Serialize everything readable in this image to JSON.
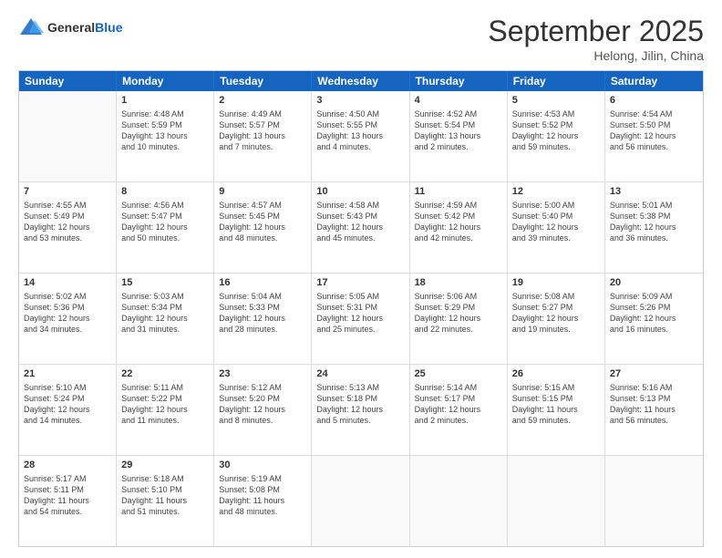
{
  "logo": {
    "general": "General",
    "blue": "Blue"
  },
  "title": "September 2025",
  "subtitle": "Helong, Jilin, China",
  "days": [
    "Sunday",
    "Monday",
    "Tuesday",
    "Wednesday",
    "Thursday",
    "Friday",
    "Saturday"
  ],
  "weeks": [
    [
      {
        "day": "",
        "info": ""
      },
      {
        "day": "1",
        "info": "Sunrise: 4:48 AM\nSunset: 5:59 PM\nDaylight: 13 hours\nand 10 minutes."
      },
      {
        "day": "2",
        "info": "Sunrise: 4:49 AM\nSunset: 5:57 PM\nDaylight: 13 hours\nand 7 minutes."
      },
      {
        "day": "3",
        "info": "Sunrise: 4:50 AM\nSunset: 5:55 PM\nDaylight: 13 hours\nand 4 minutes."
      },
      {
        "day": "4",
        "info": "Sunrise: 4:52 AM\nSunset: 5:54 PM\nDaylight: 13 hours\nand 2 minutes."
      },
      {
        "day": "5",
        "info": "Sunrise: 4:53 AM\nSunset: 5:52 PM\nDaylight: 12 hours\nand 59 minutes."
      },
      {
        "day": "6",
        "info": "Sunrise: 4:54 AM\nSunset: 5:50 PM\nDaylight: 12 hours\nand 56 minutes."
      }
    ],
    [
      {
        "day": "7",
        "info": "Sunrise: 4:55 AM\nSunset: 5:49 PM\nDaylight: 12 hours\nand 53 minutes."
      },
      {
        "day": "8",
        "info": "Sunrise: 4:56 AM\nSunset: 5:47 PM\nDaylight: 12 hours\nand 50 minutes."
      },
      {
        "day": "9",
        "info": "Sunrise: 4:57 AM\nSunset: 5:45 PM\nDaylight: 12 hours\nand 48 minutes."
      },
      {
        "day": "10",
        "info": "Sunrise: 4:58 AM\nSunset: 5:43 PM\nDaylight: 12 hours\nand 45 minutes."
      },
      {
        "day": "11",
        "info": "Sunrise: 4:59 AM\nSunset: 5:42 PM\nDaylight: 12 hours\nand 42 minutes."
      },
      {
        "day": "12",
        "info": "Sunrise: 5:00 AM\nSunset: 5:40 PM\nDaylight: 12 hours\nand 39 minutes."
      },
      {
        "day": "13",
        "info": "Sunrise: 5:01 AM\nSunset: 5:38 PM\nDaylight: 12 hours\nand 36 minutes."
      }
    ],
    [
      {
        "day": "14",
        "info": "Sunrise: 5:02 AM\nSunset: 5:36 PM\nDaylight: 12 hours\nand 34 minutes."
      },
      {
        "day": "15",
        "info": "Sunrise: 5:03 AM\nSunset: 5:34 PM\nDaylight: 12 hours\nand 31 minutes."
      },
      {
        "day": "16",
        "info": "Sunrise: 5:04 AM\nSunset: 5:33 PM\nDaylight: 12 hours\nand 28 minutes."
      },
      {
        "day": "17",
        "info": "Sunrise: 5:05 AM\nSunset: 5:31 PM\nDaylight: 12 hours\nand 25 minutes."
      },
      {
        "day": "18",
        "info": "Sunrise: 5:06 AM\nSunset: 5:29 PM\nDaylight: 12 hours\nand 22 minutes."
      },
      {
        "day": "19",
        "info": "Sunrise: 5:08 AM\nSunset: 5:27 PM\nDaylight: 12 hours\nand 19 minutes."
      },
      {
        "day": "20",
        "info": "Sunrise: 5:09 AM\nSunset: 5:26 PM\nDaylight: 12 hours\nand 16 minutes."
      }
    ],
    [
      {
        "day": "21",
        "info": "Sunrise: 5:10 AM\nSunset: 5:24 PM\nDaylight: 12 hours\nand 14 minutes."
      },
      {
        "day": "22",
        "info": "Sunrise: 5:11 AM\nSunset: 5:22 PM\nDaylight: 12 hours\nand 11 minutes."
      },
      {
        "day": "23",
        "info": "Sunrise: 5:12 AM\nSunset: 5:20 PM\nDaylight: 12 hours\nand 8 minutes."
      },
      {
        "day": "24",
        "info": "Sunrise: 5:13 AM\nSunset: 5:18 PM\nDaylight: 12 hours\nand 5 minutes."
      },
      {
        "day": "25",
        "info": "Sunrise: 5:14 AM\nSunset: 5:17 PM\nDaylight: 12 hours\nand 2 minutes."
      },
      {
        "day": "26",
        "info": "Sunrise: 5:15 AM\nSunset: 5:15 PM\nDaylight: 11 hours\nand 59 minutes."
      },
      {
        "day": "27",
        "info": "Sunrise: 5:16 AM\nSunset: 5:13 PM\nDaylight: 11 hours\nand 56 minutes."
      }
    ],
    [
      {
        "day": "28",
        "info": "Sunrise: 5:17 AM\nSunset: 5:11 PM\nDaylight: 11 hours\nand 54 minutes."
      },
      {
        "day": "29",
        "info": "Sunrise: 5:18 AM\nSunset: 5:10 PM\nDaylight: 11 hours\nand 51 minutes."
      },
      {
        "day": "30",
        "info": "Sunrise: 5:19 AM\nSunset: 5:08 PM\nDaylight: 11 hours\nand 48 minutes."
      },
      {
        "day": "",
        "info": ""
      },
      {
        "day": "",
        "info": ""
      },
      {
        "day": "",
        "info": ""
      },
      {
        "day": "",
        "info": ""
      }
    ]
  ]
}
